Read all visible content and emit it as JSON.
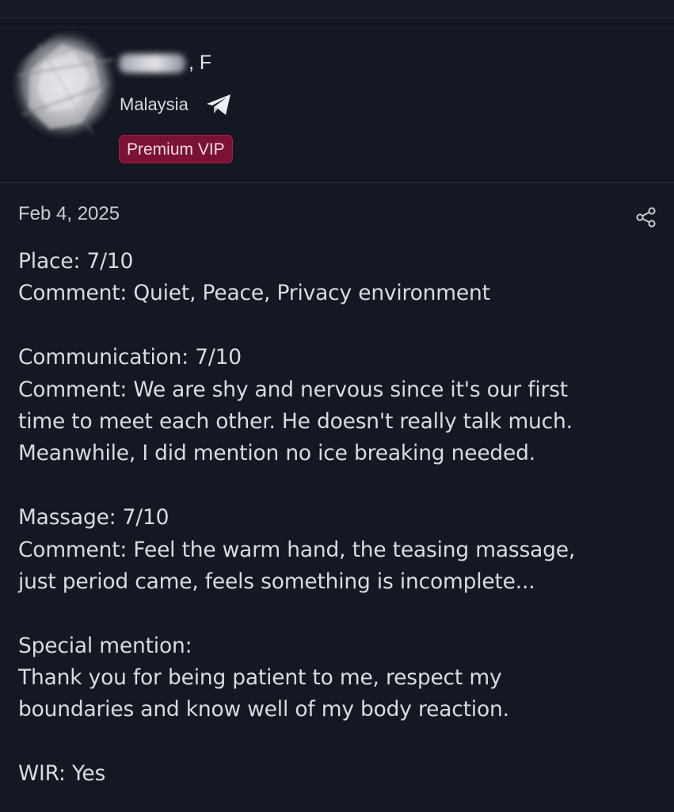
{
  "profile": {
    "name_suffix": ", F",
    "location": "Malaysia",
    "badge": "Premium VIP",
    "avatar_icon": "blurred-avatar",
    "contact_icon": "telegram-icon"
  },
  "review": {
    "date": "Feb 4, 2025",
    "share_icon": "share-icon",
    "lines": {
      "place_score": "Place: 7/10",
      "place_comment": "Comment: Quiet, Peace, Privacy environment",
      "communication_score": "Communication: 7/10",
      "communication_comment_1": "Comment: We are shy and nervous since it's our first",
      "communication_comment_2": "time to meet each other. He doesn't really talk much.",
      "communication_comment_3": "Meanwhile, I did mention no ice breaking needed.",
      "massage_score": "Massage: 7/10",
      "massage_comment_1": "Comment: Feel the warm hand, the teasing massage,",
      "massage_comment_2": "just period came, feels something is incomplete...",
      "special_heading": "Special mention:",
      "special_text_1": "Thank you for being patient to me, respect my",
      "special_text_2": "boundaries and know well of my body reaction.",
      "wir": "WIR: Yes"
    }
  },
  "colors": {
    "background": "#141822",
    "text": "#d9dbdf",
    "badge_bg": "#7a1333",
    "badge_border": "#a52049"
  }
}
